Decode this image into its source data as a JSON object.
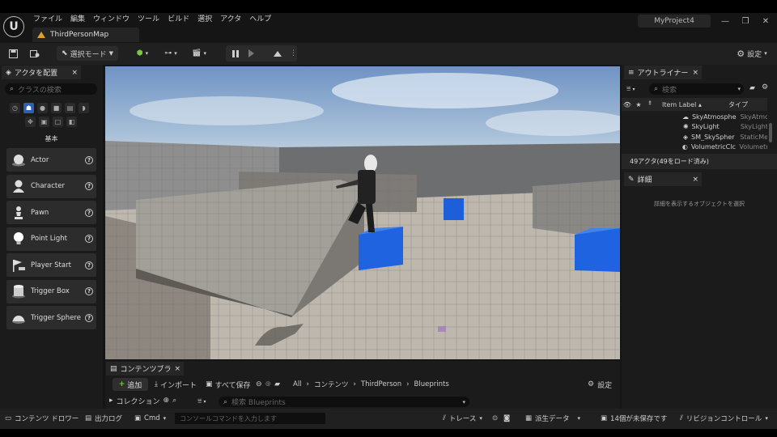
{
  "app": {
    "project": "MyProject4",
    "map_tab": "ThirdPersonMap"
  },
  "menu": [
    "ファイル",
    "編集",
    "ウィンドウ",
    "ツール",
    "ビルド",
    "選択",
    "アクタ",
    "ヘルプ"
  ],
  "toolbar": {
    "select_mode": "選択モード",
    "settings": "設定"
  },
  "place_actors": {
    "tab": "アクタを配置",
    "search_placeholder": "クラスの検索",
    "category": "基本",
    "items": [
      {
        "label": "Actor",
        "icon": "sphere-icon"
      },
      {
        "label": "Character",
        "icon": "bust-icon"
      },
      {
        "label": "Pawn",
        "icon": "pawn-icon"
      },
      {
        "label": "Point Light",
        "icon": "bulb-icon"
      },
      {
        "label": "Player Start",
        "icon": "flag-icon"
      },
      {
        "label": "Trigger Box",
        "icon": "cylinder-icon"
      },
      {
        "label": "Trigger Sphere",
        "icon": "dome-icon"
      }
    ]
  },
  "outliner": {
    "tab": "アウトライナー",
    "search_placeholder": "検索",
    "col_label": "Item Label",
    "col_type": "タイプ",
    "rows": [
      {
        "label": "SkyAtmosphe",
        "type": "SkyAtmc"
      },
      {
        "label": "SkyLight",
        "type": "SkyLight"
      },
      {
        "label": "SM_SkySpher",
        "type": "StaticMe"
      },
      {
        "label": "VolumetricClc",
        "type": "Volumetr"
      }
    ],
    "status": "49アクタ(49をロード済み)"
  },
  "details": {
    "tab": "詳細",
    "empty": "詳細を表示するオブジェクトを選択"
  },
  "content_browser": {
    "tab": "コンテンツブラウ...",
    "add": "追加",
    "import": "インポート",
    "save_all": "すべて保存",
    "crumbs": [
      "All",
      "コンテンツ",
      "ThirdPerson",
      "Blueprints"
    ],
    "settings": "設定",
    "collections": "コレクション",
    "search_placeholder": "検索 Blueprints"
  },
  "status": {
    "drawer": "コンテンツ ドロワー",
    "output": "出力ログ",
    "cmd": "Cmd",
    "console_placeholder": "コンソールコマンドを入力します",
    "trace": "トレース",
    "derived": "派生データ",
    "unsaved": "14個が未保存です",
    "revision": "リビジョンコントロール"
  }
}
